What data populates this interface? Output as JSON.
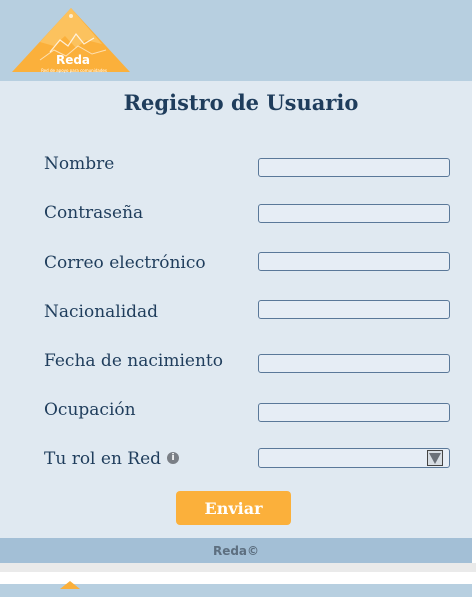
{
  "logo": {
    "name": "Reda",
    "tagline": "Red de apoyo para comunidades"
  },
  "form": {
    "title": "Registro de Usuario",
    "fields": [
      {
        "label": "Nombre",
        "value": ""
      },
      {
        "label": "Contraseña",
        "value": ""
      },
      {
        "label": "Correo electrónico",
        "value": ""
      },
      {
        "label": "Nacionalidad",
        "value": ""
      },
      {
        "label": "Fecha de nacimiento",
        "value": ""
      },
      {
        "label": "Ocupación",
        "value": ""
      }
    ],
    "role": {
      "label": "Tu rol en Red",
      "info_icon": "info-icon",
      "selected": "",
      "dropdown_icon": "triangle-down-icon"
    },
    "submit_label": "Enviar"
  },
  "footer": {
    "text": "Reda©"
  },
  "colors": {
    "header_bg": "#b7cfe0",
    "panel_bg": "#e0e9f1",
    "footer_bg": "#a3bfd6",
    "text": "#1f3d5c",
    "accent": "#fbb03b"
  }
}
